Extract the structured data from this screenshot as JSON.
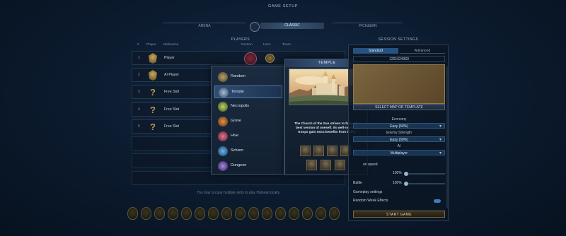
{
  "header": {
    "title": "GAME SETUP"
  },
  "modes": {
    "arena": "ARENA",
    "classic": "CLASSIC",
    "picknban": "PICK&BAN"
  },
  "players": {
    "title": "PLAYERS",
    "columns": {
      "num": "#",
      "player": "Player",
      "nickname": "Nickname",
      "faction": "Faction",
      "hero": "Hero",
      "team": "Team"
    },
    "rows": [
      {
        "num": "1",
        "name": "Player",
        "emblem": "crest"
      },
      {
        "num": "2",
        "name": "AI Player",
        "emblem": "crest"
      },
      {
        "num": "3",
        "name": "Free Slot",
        "emblem": "question"
      },
      {
        "num": "4",
        "name": "Free Slot",
        "emblem": "question"
      },
      {
        "num": "5",
        "name": "Free Slot",
        "emblem": "question"
      }
    ],
    "hint": "You may occupy multiple slots to play Hotseat locally."
  },
  "faction_menu": {
    "items": [
      {
        "label": "Random",
        "color": "#8c7a55"
      },
      {
        "label": "Temple",
        "color": "#4a6a8f",
        "selected": true
      },
      {
        "label": "Necropolis",
        "color": "#6f8c3a"
      },
      {
        "label": "Grove",
        "color": "#b3662a"
      },
      {
        "label": "Hive",
        "color": "#a83a55"
      },
      {
        "label": "Schism",
        "color": "#2f6fa8"
      },
      {
        "label": "Dungeon",
        "color": "#5a3a8f"
      }
    ]
  },
  "info": {
    "title": "TEMPLE",
    "description": "The Church of the Sun strives to forge the best version of oneself. Its well-rounded troops gain extra benefits from buffs."
  },
  "session": {
    "title": "SESSION SETTINGS",
    "tab_standard": "Standard",
    "tab_advanced": "Advanced",
    "seed": "1201624969",
    "map_button": "SELECT MAP OR TEMPLATE",
    "economy_label": "Economy",
    "economy_value": "Easy (50%)",
    "enemy_label": "Enemy Strength",
    "enemy_value": "Easy (50%)",
    "ai_label": "AI",
    "ai_value": "Multiplayer",
    "animation_label": "on speed",
    "animation_value": "100%",
    "battle_label": "Battle",
    "battle_value": "100%",
    "gameplay_label": "Gameplay settings",
    "random_week_label": "Random Week Effects",
    "start": "START GAME"
  }
}
